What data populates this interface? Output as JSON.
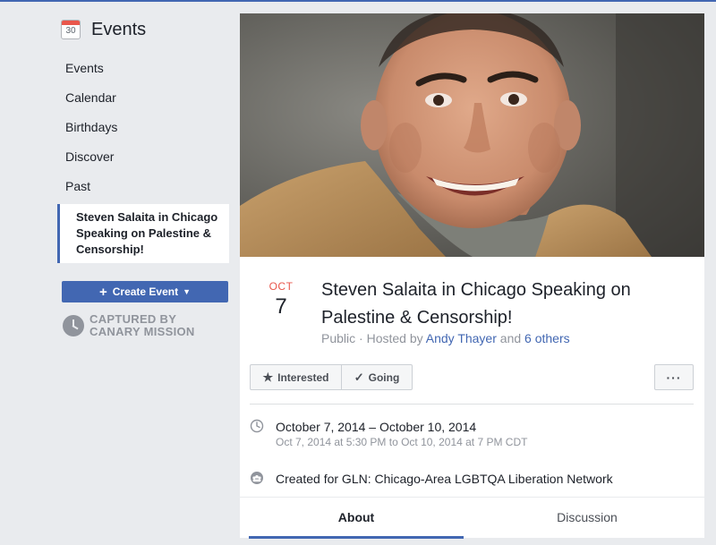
{
  "sidebar": {
    "title": "Events",
    "calendar_icon_number": "30",
    "items": [
      {
        "label": "Events"
      },
      {
        "label": "Calendar"
      },
      {
        "label": "Birthdays"
      },
      {
        "label": "Discover"
      },
      {
        "label": "Past"
      }
    ],
    "active_item": "Steven Salaita in Chicago Speaking on Palestine & Censorship!",
    "create_button": "Create Event",
    "watermark_line1": "CAPTURED BY",
    "watermark_line2": "CANARY MISSION"
  },
  "event": {
    "month": "OCT",
    "day": "7",
    "title": "Steven Salaita in Chicago Speaking on Palestine & Censorship!",
    "privacy": "Public",
    "hosted_by_prefix": "Hosted by",
    "host": "Andy Thayer",
    "and_text": "and",
    "others": "6 others",
    "interested_label": "Interested",
    "going_label": "Going",
    "more_label": "···",
    "date_range": "October 7, 2014 – October 10, 2014",
    "time_detail": "Oct 7, 2014 at 5:30 PM to Oct 10, 2014 at 7 PM CDT",
    "group": "Created for GLN: Chicago-Area LGBTQA Liberation Network"
  },
  "tabs": [
    {
      "label": "About",
      "active": true
    },
    {
      "label": "Discussion",
      "active": false
    }
  ],
  "colors": {
    "accent": "#4267b2",
    "month_red": "#e9574c",
    "background": "#e9ebee"
  }
}
